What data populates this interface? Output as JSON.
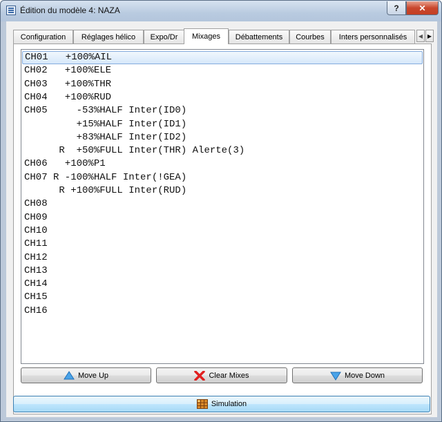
{
  "window": {
    "title": "Édition du modèle 4: NAZA",
    "help_label": "?",
    "close_label": "✕"
  },
  "tabs": [
    {
      "label": "Configuration"
    },
    {
      "label": "Réglages hélico"
    },
    {
      "label": "Expo/Dr"
    },
    {
      "label": "Mixages"
    },
    {
      "label": "Débattements"
    },
    {
      "label": "Courbes"
    },
    {
      "label": "Inters personnalisés"
    }
  ],
  "active_tab": "Mixages",
  "tab_scroll": {
    "left": "◀",
    "right": "▶"
  },
  "mixes": [
    "CH01   +100%AIL",
    "CH02   +100%ELE",
    "CH03   +100%THR",
    "CH04   +100%RUD",
    "CH05     -53%HALF Inter(ID0)",
    "         +15%HALF Inter(ID1)",
    "         +83%HALF Inter(ID2)",
    "      R  +50%FULL Inter(THR) Alerte(3)",
    "CH06   +100%P1",
    "CH07 R -100%HALF Inter(!GEA)",
    "      R +100%FULL Inter(RUD)",
    "CH08",
    "CH09",
    "CH10",
    "CH11",
    "CH12",
    "CH13",
    "CH14",
    "CH15",
    "CH16"
  ],
  "selected_row": 0,
  "buttons": {
    "move_up": "Move Up",
    "clear_mixes": "Clear Mixes",
    "move_down": "Move Down",
    "simulation": "Simulation"
  },
  "icons": {
    "app": "app-window-icon",
    "move_up": "blue-up-arrow-icon",
    "clear": "red-x-icon",
    "move_down": "blue-down-arrow-icon",
    "simulation": "grid-calculator-icon"
  }
}
